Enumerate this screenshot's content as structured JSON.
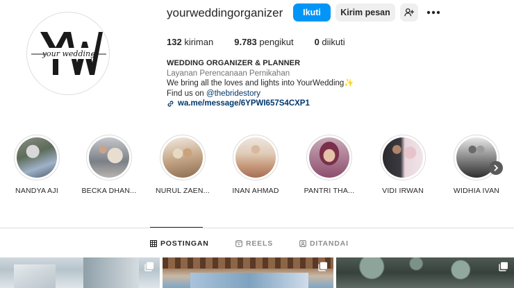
{
  "profile": {
    "username": "yourweddingorganizer",
    "avatar_monogram": "YW",
    "avatar_script": "your wedding",
    "follow_label": "Ikuti",
    "message_label": "Kirim pesan",
    "add_person_icon": "person-add-icon",
    "more_icon": "more-horizontal-icon"
  },
  "stats": {
    "posts_count": "132",
    "posts_label": "kiriman",
    "followers_count": "9.783",
    "followers_label": "pengikut",
    "following_count": "0",
    "following_label": "diikuti"
  },
  "bio": {
    "name": "WEDDING ORGANIZER & PLANNER",
    "category": "Layanan Perencanaan Pernikahan",
    "line1": "We bring all the loves and lights into YourWedding",
    "line1_emoji": "✨",
    "line2_prefix": "Find us on ",
    "mention": "@thebridestory",
    "link": "wa.me/message/6YPWI657S4CXP1"
  },
  "highlights": [
    {
      "label": "NANDYA AJI"
    },
    {
      "label": "BECKA DHAN..."
    },
    {
      "label": "NURUL ZAEN..."
    },
    {
      "label": "INAN AHMAD"
    },
    {
      "label": "PANTRI THA..."
    },
    {
      "label": "VIDI IRWAN"
    },
    {
      "label": "WIDHIA IVAN"
    }
  ],
  "tabs": [
    {
      "label": "POSTINGAN",
      "icon": "grid-icon",
      "active": true
    },
    {
      "label": "REELS",
      "icon": "reels-icon",
      "active": false
    },
    {
      "label": "DITANDAI",
      "icon": "tagged-icon",
      "active": false
    }
  ],
  "colors": {
    "primary_button": "#0095f6",
    "secondary_button": "#efefef",
    "text": "#262626",
    "muted": "#737373",
    "link": "#00376b"
  }
}
